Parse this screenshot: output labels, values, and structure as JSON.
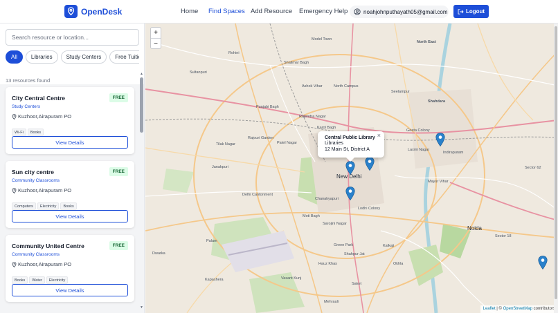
{
  "app": {
    "name": "OpenDesk"
  },
  "nav": {
    "home": "Home",
    "find_spaces": "Find Spaces",
    "add_resource": "Add Resource",
    "emergency_help": "Emergency Help"
  },
  "user": {
    "email": "noahjohnputhayath05@gmail.com"
  },
  "logout_label": "Logout",
  "search": {
    "placeholder": "Search resource or location..."
  },
  "filters": [
    "All",
    "Libraries",
    "Study Centers",
    "Free Tuition NGOs"
  ],
  "active_filter": "All",
  "results_count": "13 resources found",
  "resources": [
    {
      "title": "City Central Centre",
      "badge": "FREE",
      "category": "Study Centers",
      "location": "Kuzhoor,Airapuram PO",
      "tags": [
        "Wi-Fi",
        "Books"
      ],
      "button": "View Details"
    },
    {
      "title": "Sun city centre",
      "badge": "FREE",
      "category": "Community Classrooms",
      "location": "Kuzhoor,Airapuram PO",
      "tags": [
        "Computers",
        "Electricity",
        "Books"
      ],
      "button": "View Details"
    },
    {
      "title": "Community United Centre",
      "badge": "FREE",
      "category": "Community Classrooms",
      "location": "Kuzhoor,Airapuram PO",
      "tags": [
        "Books",
        "Water",
        "Electricity"
      ],
      "button": "View Details"
    }
  ],
  "map": {
    "zoom_in": "+",
    "zoom_out": "−",
    "popup": {
      "title": "Central Public Library",
      "category": "Libraries",
      "address": "12 Main St, District A",
      "close": "×"
    },
    "labels": [
      "Model Town",
      "Shalimar Bagh",
      "North East",
      "Sultanpuri",
      "Ashok Vihar",
      "North Campus",
      "Seelampur",
      "Shahdara",
      "Rohini",
      "Punjabi Bagh",
      "Karol Bagh",
      "Patel Nagar",
      "Geeta Colony",
      "Rajendra Nagar",
      "Tilak Nagar",
      "Janakpuri",
      "Rajouri Garden",
      "New Delhi",
      "Chanakyapuri",
      "Lodhi Colony",
      "Laxmi Nagar",
      "Indirapuram",
      "Mayur Vihar",
      "Delhi Cantonment",
      "Dwarka",
      "Moti Bagh",
      "Sarojini Nagar",
      "Green Park",
      "Kalkaji",
      "Noida",
      "Palam",
      "Vasant Kunj",
      "Hauz Khas",
      "Shahpur Jat",
      "Okhla",
      "Saket",
      "Mehrauli",
      "Sector 62",
      "Sector 18",
      "Kapashera"
    ],
    "attribution": {
      "leaflet": "Leaflet",
      "sep": " | © ",
      "osm": "OpenStreetMap",
      "suffix": " contributors"
    }
  }
}
